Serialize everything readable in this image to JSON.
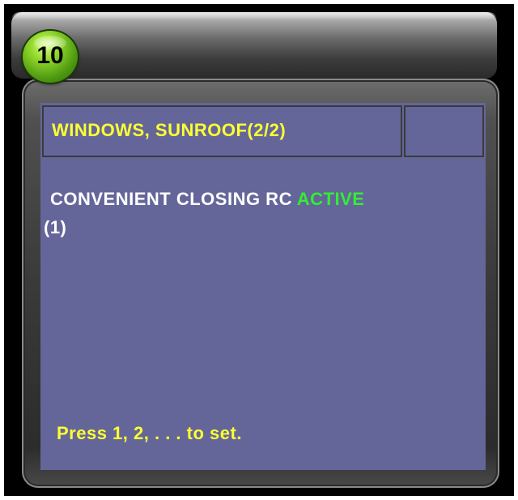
{
  "badge": {
    "number": "10"
  },
  "screen": {
    "title": "WINDOWS, SUNROOF(2/2)",
    "setting_label": "CONVENIENT CLOSING RC",
    "setting_status": "ACTIVE",
    "setting_index": "(1)",
    "hint": "Press 1, 2, . . . to set."
  },
  "colors": {
    "panel_background": "#64669a",
    "title_text": "#ffff33",
    "status_active": "#33ee33",
    "badge": "#6cbf1e"
  }
}
